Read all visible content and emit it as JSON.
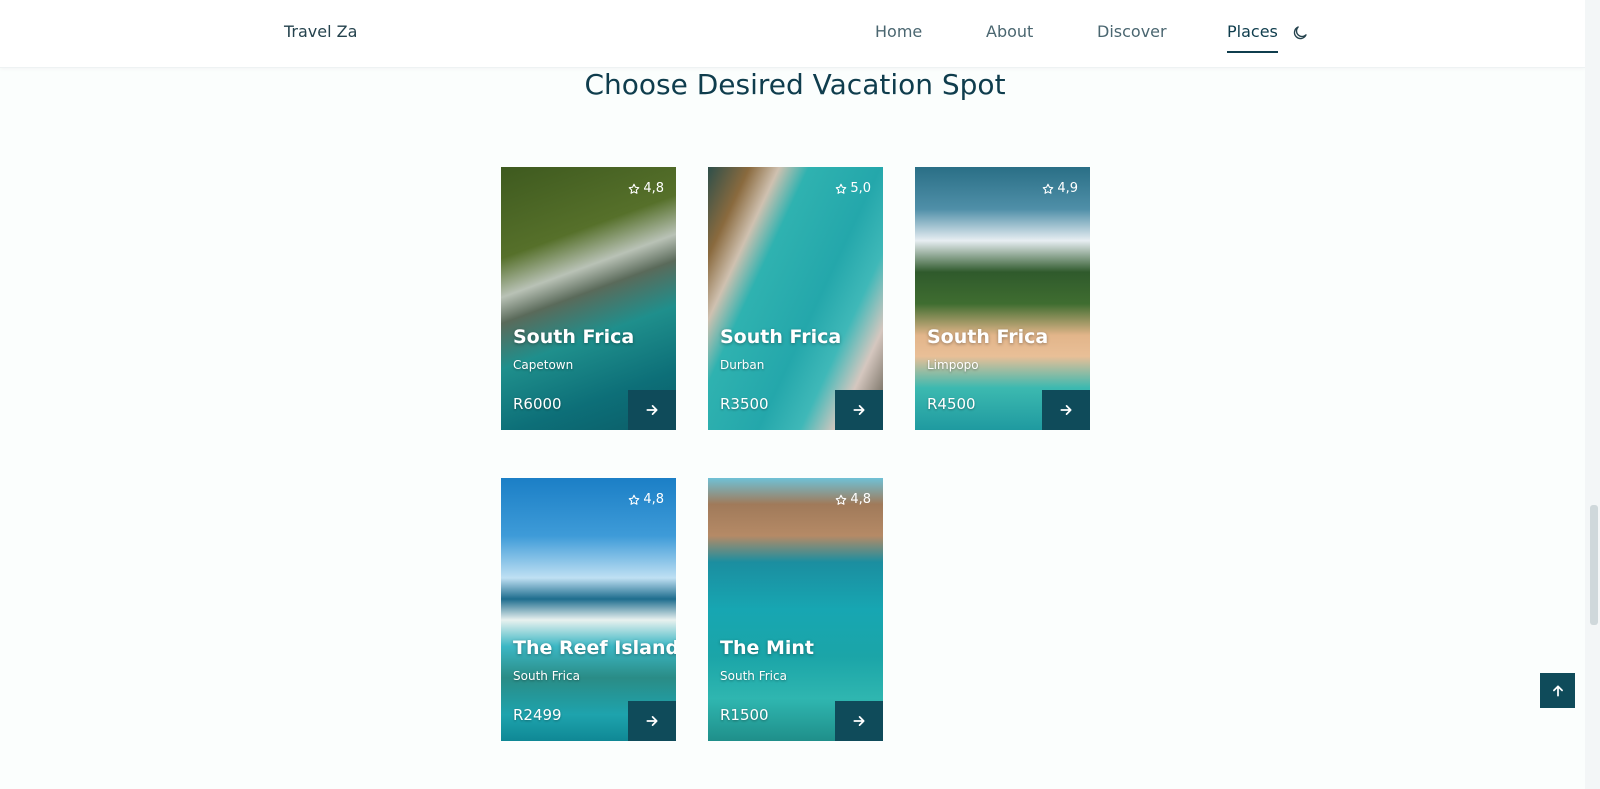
{
  "header": {
    "brand": "Travel Za",
    "nav": [
      "Home",
      "About",
      "Discover",
      "Places"
    ],
    "active": "Places",
    "theme_icon": "moon-icon"
  },
  "section": {
    "title": "Choose Desired Vacation Spot"
  },
  "places": [
    {
      "title": "South Frica",
      "subtitle": "Capetown",
      "price": "R6000",
      "rating": "4,8"
    },
    {
      "title": "South Frica",
      "subtitle": "Durban",
      "price": "R3500",
      "rating": "5,0"
    },
    {
      "title": "South Frica",
      "subtitle": "Limpopo",
      "price": "R4500",
      "rating": "4,9"
    },
    {
      "title": "The Reef Island",
      "subtitle": "South Frica",
      "price": "R2499",
      "rating": "4,8"
    },
    {
      "title": "The Mint",
      "subtitle": "South Frica",
      "price": "R1500",
      "rating": "4,8"
    }
  ],
  "colors": {
    "accent": "#0f4b5a",
    "text": "#0f3d4d"
  },
  "icons": {
    "rating": "star-icon",
    "card_button": "arrow-right-icon",
    "scroll_top": "arrow-up-icon"
  }
}
